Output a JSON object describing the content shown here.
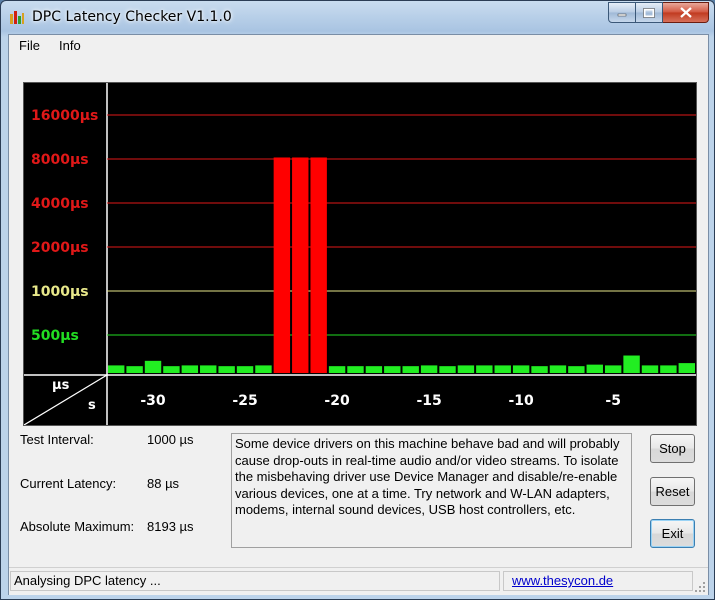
{
  "window": {
    "title": "DPC Latency Checker V1.1.0"
  },
  "menu": {
    "items": [
      "File",
      "Info"
    ]
  },
  "graph": {
    "y_labels": [
      {
        "text": "16000µs",
        "value": 16000,
        "color": "#e01818"
      },
      {
        "text": "8000µs",
        "value": 8000,
        "color": "#e01818"
      },
      {
        "text": "4000µs",
        "value": 4000,
        "color": "#e01818"
      },
      {
        "text": "2000µs",
        "value": 2000,
        "color": "#e01818"
      },
      {
        "text": "1000µs",
        "value": 1000,
        "color": "#e8e88a"
      },
      {
        "text": "500µs",
        "value": 500,
        "color": "#22dd22"
      }
    ],
    "corner_top": "µs",
    "corner_bottom": "s",
    "x_labels": [
      "-30",
      "-25",
      "-20",
      "-15",
      "-10",
      "-5"
    ],
    "colors": {
      "red": "#ff0000",
      "green": "#22ee22",
      "yellow_line": "#e8e88a",
      "green_line": "#22dd22"
    }
  },
  "chart_data": {
    "type": "bar",
    "x": [
      -32,
      -31,
      -30,
      -29,
      -28,
      -27,
      -26,
      -25,
      -24,
      -23,
      -22,
      -21,
      -20,
      -19,
      -18,
      -17,
      -16,
      -15,
      -14,
      -13,
      -12,
      -11,
      -10,
      -9,
      -8,
      -7,
      -6,
      -5,
      -4,
      -3,
      -2,
      -1
    ],
    "values": [
      100,
      90,
      160,
      90,
      100,
      100,
      90,
      90,
      100,
      8193,
      8193,
      8193,
      90,
      90,
      90,
      90,
      90,
      100,
      90,
      100,
      100,
      100,
      100,
      90,
      100,
      90,
      110,
      100,
      230,
      100,
      100,
      130
    ],
    "title": "",
    "xlabel": "s",
    "ylabel": "µs",
    "yscale": "log",
    "yticks": [
      500,
      1000,
      2000,
      4000,
      8000,
      16000
    ]
  },
  "params": {
    "test_interval_label": "Test Interval:",
    "test_interval_value": "1000 µs",
    "current_latency_label": "Current Latency:",
    "current_latency_value": "88 µs",
    "abs_max_label": "Absolute Maximum:",
    "abs_max_value": "8193 µs"
  },
  "message": "Some device drivers on this machine behave bad and will probably cause drop-outs in real-time audio and/or video streams. To isolate the misbehaving driver use Device Manager and disable/re-enable various devices, one at a time. Try network and W-LAN adapters, modems, internal sound devices, USB host controllers, etc.",
  "buttons": {
    "stop": "Stop",
    "reset": "Reset",
    "exit": "Exit"
  },
  "status": {
    "text": "Analysing DPC latency ...",
    "link": "www.thesycon.de"
  }
}
